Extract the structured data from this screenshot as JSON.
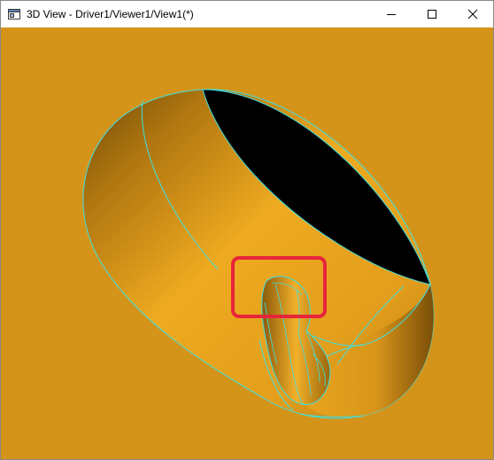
{
  "window": {
    "title": "3D View - Driver1/Viewer1/View1(*)",
    "icon": "window-app-icon",
    "controls": {
      "minimize": "minimize-icon",
      "maximize": "maximize-icon",
      "close": "close-icon"
    }
  },
  "viewport": {
    "background_color": "#D4941A",
    "model_color": "#E8A41E",
    "edge_color": "#40E0E0",
    "hole_color": "#000000",
    "highlight_box_color": "#E8243C"
  }
}
